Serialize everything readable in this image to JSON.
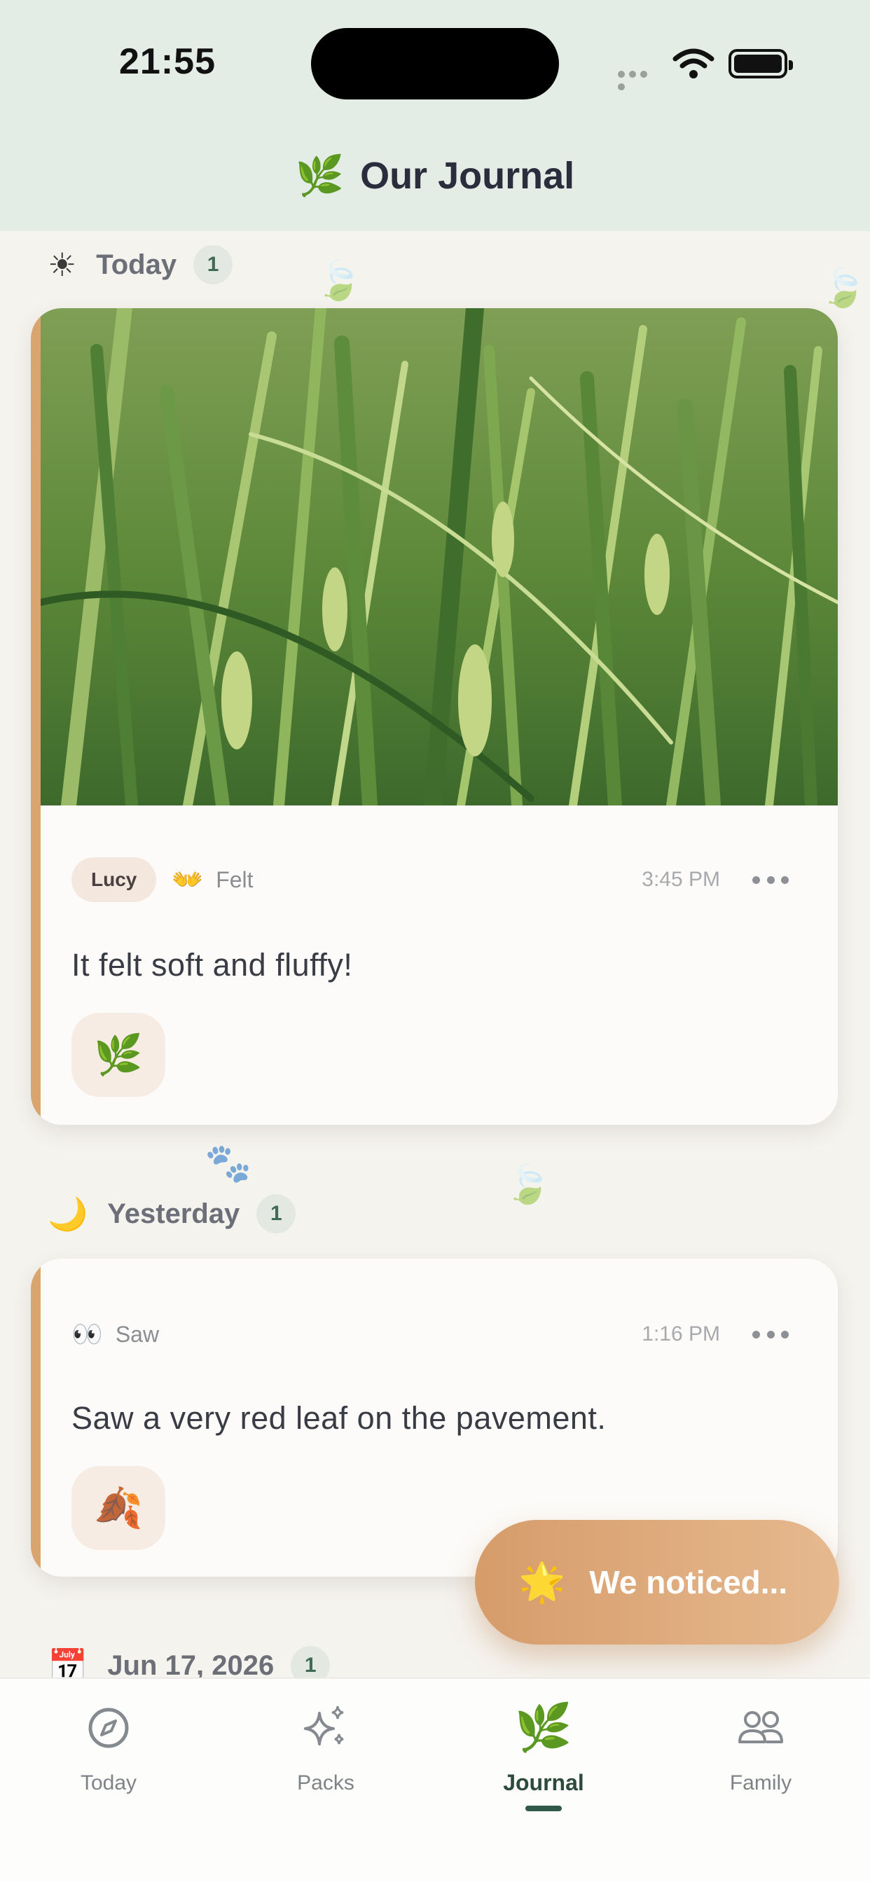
{
  "status_bar": {
    "time": "21:55"
  },
  "header": {
    "icon": "🌿",
    "title": "Our Journal"
  },
  "sections": [
    {
      "icon": "☀",
      "label": "Today",
      "count": "1"
    },
    {
      "icon": "🌙",
      "label": "Yesterday",
      "count": "1"
    },
    {
      "icon": "📅",
      "label": "Jun 17, 2026",
      "count": "1"
    }
  ],
  "entries": [
    {
      "author": "Lucy",
      "sense_icon": "👐",
      "sense": "Felt",
      "time": "3:45 PM",
      "text": "It felt soft and fluffy!",
      "tile_emoji": "🌿"
    },
    {
      "sense_icon": "👀",
      "sense": "Saw",
      "time": "1:16 PM",
      "text": "Saw a very red leaf on the pavement.",
      "tile_emoji": "🍂"
    }
  ],
  "fab": {
    "icon": "🌟",
    "label": "We noticed..."
  },
  "tabs": [
    {
      "label": "Today",
      "icon": "compass-icon"
    },
    {
      "label": "Packs",
      "icon": "sparkles-icon"
    },
    {
      "label": "Journal",
      "icon": "leaf-icon",
      "active": true
    },
    {
      "label": "Family",
      "icon": "people-icon"
    }
  ],
  "colors": {
    "accent": "#d9a46e",
    "active_tab": "#2d4a3d",
    "header_bg": "#e4ece6"
  }
}
